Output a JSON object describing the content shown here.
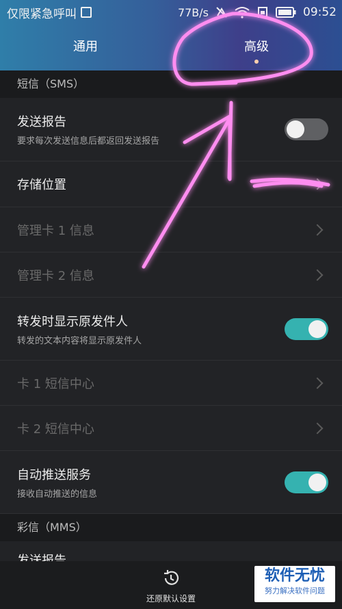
{
  "status_bar": {
    "carrier": "仅限紧急呼叫",
    "speed": "77B/s",
    "time": "09:52",
    "icons": [
      "image-icon",
      "mute-icon",
      "wifi-icon",
      "sim-icon",
      "battery-icon"
    ]
  },
  "tabs": [
    {
      "label": "通用",
      "active": false
    },
    {
      "label": "高级",
      "active": true
    }
  ],
  "sms_section": {
    "header": "短信（SMS）",
    "rows": {
      "delivery_report": {
        "title": "发送报告",
        "subtitle": "要求每次发送信息后都返回发送报告",
        "toggle": "off"
      },
      "storage": {
        "title": "存储位置"
      },
      "manage_card1": {
        "title": "管理卡 1 信息"
      },
      "manage_card2": {
        "title": "管理卡 2 信息"
      },
      "forward_show_sender": {
        "title": "转发时显示原发件人",
        "subtitle": "转发的文本内容将显示原发件人",
        "toggle": "on"
      },
      "card1_center": {
        "title": "卡 1 短信中心"
      },
      "card2_center": {
        "title": "卡 2 短信中心"
      },
      "auto_push": {
        "title": "自动推送服务",
        "subtitle": "接收自动推送的信息",
        "toggle": "on"
      }
    }
  },
  "mms_section": {
    "header": "彩信（MMS）",
    "partial_row_title": "发送报告"
  },
  "bottom": {
    "restore_label": "还原默认设置"
  },
  "watermark": {
    "title": "软件无忧",
    "subtitle": "努力解决软件问题"
  },
  "colors": {
    "accent_toggle_on": "#35b2b0",
    "annotation": "#ff2bd6"
  }
}
